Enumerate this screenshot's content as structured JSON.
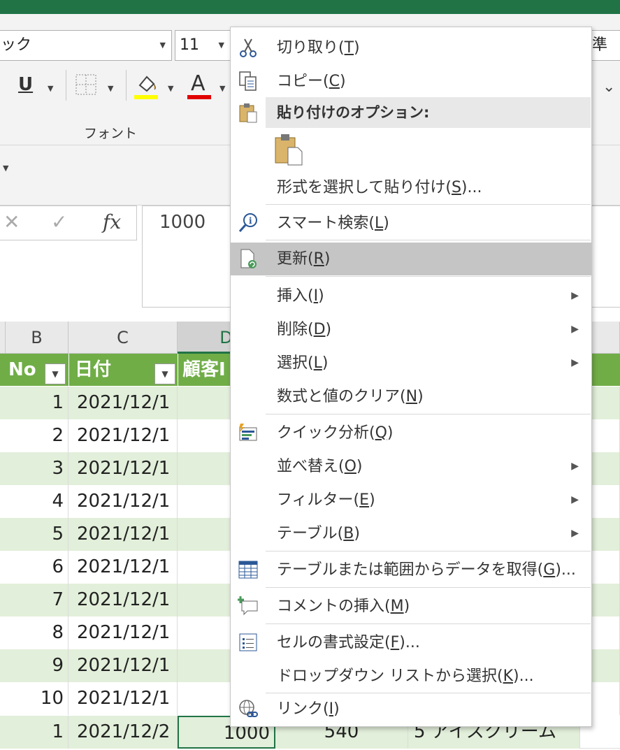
{
  "ribbon": {
    "font_name": "ック",
    "font_size": "11",
    "style_name": "準",
    "group_label": "フォント",
    "underline_label": "U",
    "font_color_label": "A"
  },
  "formula_bar": {
    "value": "1000",
    "fx_label": "fx"
  },
  "columns": [
    "B",
    "C",
    "D"
  ],
  "table_headers": [
    "No",
    "日付",
    "顧客I"
  ],
  "rows": [
    {
      "no": "1",
      "date": "2021/12/1"
    },
    {
      "no": "2",
      "date": "2021/12/1"
    },
    {
      "no": "3",
      "date": "2021/12/1"
    },
    {
      "no": "4",
      "date": "2021/12/1"
    },
    {
      "no": "5",
      "date": "2021/12/1"
    },
    {
      "no": "6",
      "date": "2021/12/1"
    },
    {
      "no": "7",
      "date": "2021/12/1"
    },
    {
      "no": "8",
      "date": "2021/12/1"
    },
    {
      "no": "9",
      "date": "2021/12/1"
    },
    {
      "no": "10",
      "date": "2021/12/1"
    }
  ],
  "last_row": {
    "no": "1",
    "date": "2021/12/2",
    "cust": "1000",
    "amount": "540",
    "product": "5 アイスクリーム"
  },
  "context_menu": {
    "cut": {
      "text": "切り取り(",
      "key": "T",
      "end": ")"
    },
    "copy": {
      "text": "コピー(",
      "key": "C",
      "end": ")"
    },
    "paste_options": "貼り付けのオプション:",
    "paste_special": {
      "text": "形式を選択して貼り付け(",
      "key": "S",
      "end": ")..."
    },
    "smart_lookup": {
      "text": "スマート検索(",
      "key": "L",
      "end": ")"
    },
    "refresh": {
      "text": "更新(",
      "key": "R",
      "end": ")"
    },
    "insert": {
      "text": "挿入(",
      "key": "I",
      "end": ")"
    },
    "delete": {
      "text": "削除(",
      "key": "D",
      "end": ")"
    },
    "select": {
      "text": "選択(",
      "key": "L",
      "end": ")"
    },
    "clear": {
      "text": "数式と値のクリア(",
      "key": "N",
      "end": ")"
    },
    "quick_analysis": {
      "text": "クイック分析(",
      "key": "Q",
      "end": ")"
    },
    "sort": {
      "text": "並べ替え(",
      "key": "O",
      "end": ")"
    },
    "filter": {
      "text": "フィルター(",
      "key": "E",
      "end": ")"
    },
    "table": {
      "text": "テーブル(",
      "key": "B",
      "end": ")"
    },
    "get_data": {
      "text": "テーブルまたは範囲からデータを取得(",
      "key": "G",
      "end": ")..."
    },
    "comment": {
      "text": "コメントの挿入(",
      "key": "M",
      "end": ")"
    },
    "format_cells": {
      "text": "セルの書式設定(",
      "key": "F",
      "end": ")..."
    },
    "dropdown": {
      "text": "ドロップダウン リストから選択(",
      "key": "K",
      "end": ")..."
    },
    "link": {
      "text": "リンク(",
      "key": "I",
      "end": ")"
    }
  },
  "colors": {
    "excel_green": "#217346",
    "table_header": "#70ad47",
    "band": "#e2efda",
    "highlight": "#c5c5c5"
  }
}
